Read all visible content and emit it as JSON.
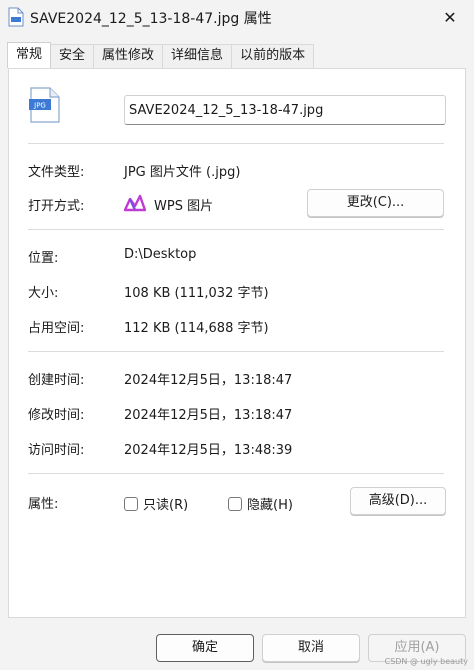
{
  "window": {
    "title": "SAVE2024_12_5_13-18-47.jpg 属性",
    "close_glyph": "✕"
  },
  "tabs": [
    {
      "label": "常规",
      "active": true
    },
    {
      "label": "安全",
      "active": false
    },
    {
      "label": "属性修改",
      "active": false
    },
    {
      "label": "详细信息",
      "active": false
    },
    {
      "label": "以前的版本",
      "active": false
    }
  ],
  "general": {
    "file_icon_label": "JPG",
    "filename": "SAVE2024_12_5_13-18-47.jpg",
    "file_type_label": "文件类型:",
    "file_type_value": "JPG 图片文件 (.jpg)",
    "open_with_label": "打开方式:",
    "open_with_value": "WPS 图片",
    "change_button": "更改(C)...",
    "location_label": "位置:",
    "location_value": "D:\\Desktop",
    "size_label": "大小:",
    "size_value": "108 KB (111,032 字节)",
    "disk_size_label": "占用空间:",
    "disk_size_value": "112 KB (114,688 字节)",
    "created_label": "创建时间:",
    "created_value": "2024年12月5日，13:18:47",
    "modified_label": "修改时间:",
    "modified_value": "2024年12月5日，13:18:47",
    "accessed_label": "访问时间:",
    "accessed_value": "2024年12月5日，13:48:39",
    "attributes_label": "属性:",
    "readonly_label": "只读(R)",
    "hidden_label": "隐藏(H)",
    "advanced_button": "高级(D)..."
  },
  "footer": {
    "ok": "确定",
    "cancel": "取消",
    "apply": "应用(A)"
  },
  "watermark": "CSDN @ ugly beauty",
  "colors": {
    "accent": "#0067c0",
    "wps_logo": "#c23bd4"
  }
}
